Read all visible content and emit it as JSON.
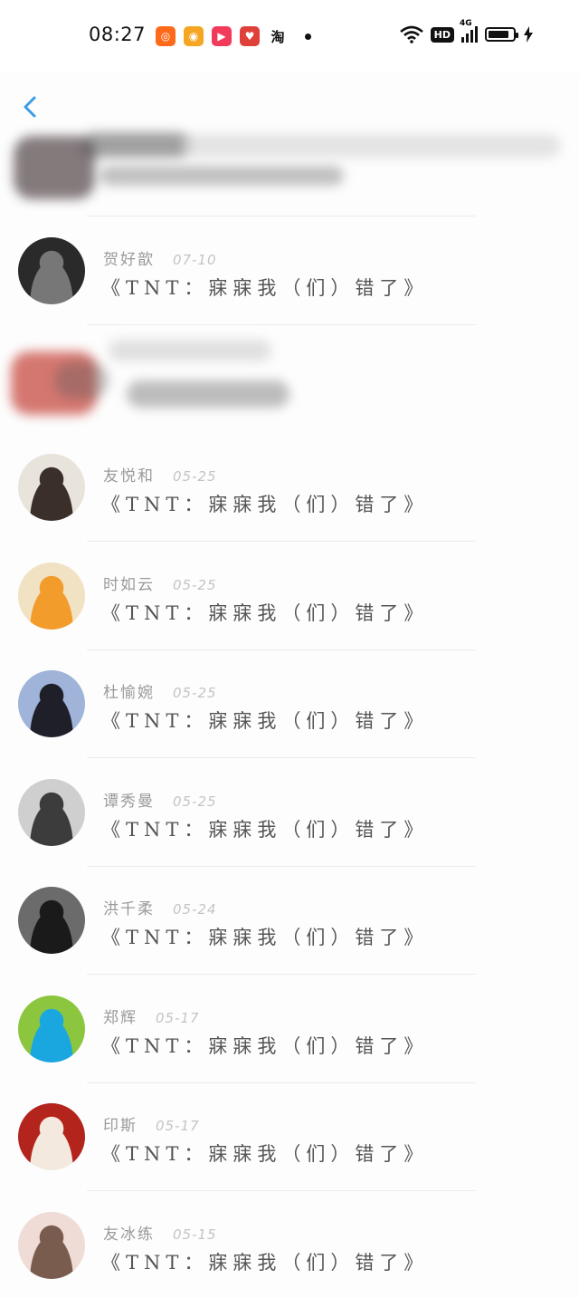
{
  "status_bar": {
    "time": "08:27",
    "app_icons": [
      {
        "name": "kuaishou-icon",
        "glyph": "◎",
        "color": "#ff6a1a"
      },
      {
        "name": "weibo-icon",
        "glyph": "◉",
        "color": "#f5a623"
      },
      {
        "name": "video-play-icon",
        "glyph": "▶",
        "color": "#f23a5a"
      },
      {
        "name": "pinduoduo-icon",
        "glyph": "♥",
        "color": "#e0403a"
      },
      {
        "name": "taobao-icon",
        "glyph": "淘",
        "color": "#ffffff"
      }
    ],
    "hd_label": "HD",
    "network_label": "4G",
    "battery_level": 0.85
  },
  "header": {
    "back_icon": "chevron-left-icon",
    "accent_color": "#3a9be8"
  },
  "messages": [
    {
      "name": "贺好歆",
      "date": "07-10",
      "text": "《TNT：寐寐我（们）错了》",
      "avatar_color": "#2a2a2a",
      "avatar_accent": "#777"
    },
    {
      "name": "友悦和",
      "date": "05-25",
      "text": "《TNT：寐寐我（们）错了》",
      "avatar_color": "#e8e4dc",
      "avatar_accent": "#3b2f2a"
    },
    {
      "name": "时如云",
      "date": "05-25",
      "text": "《TNT：寐寐我（们）错了》",
      "avatar_color": "#f2e2c4",
      "avatar_accent": "#f29c2b"
    },
    {
      "name": "杜愉婉",
      "date": "05-25",
      "text": "《TNT：寐寐我（们）错了》",
      "avatar_color": "#9fb4d8",
      "avatar_accent": "#1f1f2a"
    },
    {
      "name": "谭秀曼",
      "date": "05-25",
      "text": "《TNT：寐寐我（们）错了》",
      "avatar_color": "#cfcfcf",
      "avatar_accent": "#3c3c3c"
    },
    {
      "name": "洪千柔",
      "date": "05-24",
      "text": "《TNT：寐寐我（们）错了》",
      "avatar_color": "#6b6b6b",
      "avatar_accent": "#1a1a1a"
    },
    {
      "name": "郑辉",
      "date": "05-17",
      "text": "《TNT：寐寐我（们）错了》",
      "avatar_color": "#8cc63f",
      "avatar_accent": "#1aa7e0"
    },
    {
      "name": "印斯",
      "date": "05-17",
      "text": "《TNT：寐寐我（们）错了》",
      "avatar_color": "#b3241d",
      "avatar_accent": "#f4e9df"
    },
    {
      "name": "友冰练",
      "date": "05-15",
      "text": "《TNT：寐寐我（们）错了》",
      "avatar_color": "#f0dcd6",
      "avatar_accent": "#7a5c4f"
    }
  ]
}
